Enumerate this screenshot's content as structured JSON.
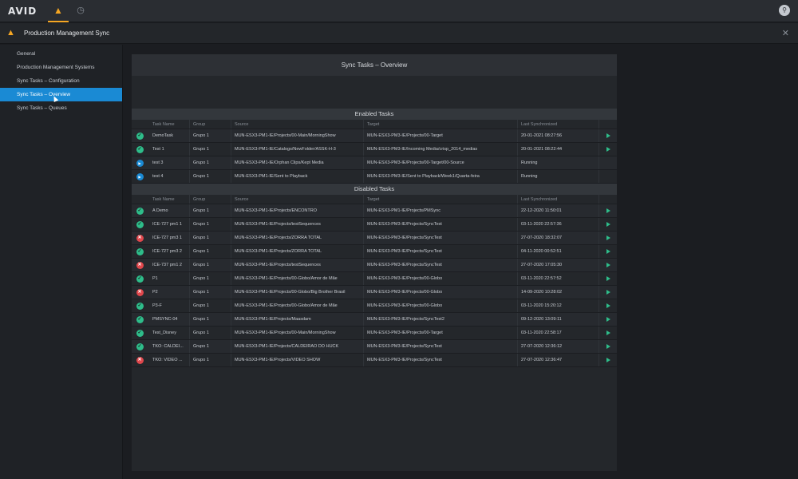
{
  "topbar": {
    "logo": "AVID",
    "app_icon": "production-management-icon",
    "history_icon": "history-icon",
    "user_icon": "user-icon",
    "user_glyph": "⚲"
  },
  "titlebar": {
    "title": "Production Management Sync",
    "close_glyph": "✕"
  },
  "sidebar": {
    "items": [
      {
        "label": "General",
        "active": false
      },
      {
        "label": "Production Management Systems",
        "active": false
      },
      {
        "label": "Sync Tasks – Configuration",
        "active": false
      },
      {
        "label": "Sync Tasks – Overview",
        "active": true
      },
      {
        "label": "Sync Tasks – Queues",
        "active": false
      }
    ]
  },
  "panel": {
    "title": "Sync Tasks – Overview",
    "columns": {
      "name": "Task Name",
      "group": "Group",
      "source": "Source",
      "target": "Target",
      "last": "Last Synchronized"
    },
    "enabled": {
      "title": "Enabled Tasks",
      "rows": [
        {
          "status": "ok",
          "name": "DemoTask",
          "group": "Grupo 1",
          "source": "MUN-ESX3-PM1-IE/Projects/00-Main/MorningShow",
          "target": "MUN-ESX3-PM3-IE/Projects/00-Target",
          "last": "20-01-2021 08:27:56",
          "action": true
        },
        {
          "status": "ok",
          "name": "Test 1",
          "group": "Grupo 1",
          "source": "MUN-ESX3-PM1-IE/Catalogs/NewFolder/ASSK-H-3",
          "target": "MUN-ESX3-PM3-IE/Incoming Media/crisp_2014_medias",
          "last": "20-01-2021 08:22:44",
          "action": true
        },
        {
          "status": "run",
          "name": "test 3",
          "group": "Grupo 1",
          "source": "MUN-ESX3-PM1-IE/Orphan Clips/Kept Media",
          "target": "MUN-ESX3-PM3-IE/Projects/00-Target/00-Source",
          "last": "Running",
          "action": false
        },
        {
          "status": "run",
          "name": "test 4",
          "group": "Grupo 1",
          "source": "MUN-ESX3-PM1-IE/Sent to Playback",
          "target": "MUN-ESX3-PM3-IE/Sent to Playback/Week1/Quarta-feira",
          "last": "Running",
          "action": false
        }
      ]
    },
    "disabled": {
      "title": "Disabled Tasks",
      "rows": [
        {
          "status": "ok",
          "name": "A Demo",
          "group": "Grupo 1",
          "source": "MUN-ESX3-PM1-IE/Projects/ENCONTRO",
          "target": "MUN-ESX3-PM1-IE/Projects/PMSync",
          "last": "22-12-2020 11:50:01",
          "action": true
        },
        {
          "status": "ok",
          "name": "ICE-727 pm1 1",
          "group": "Grupo 1",
          "source": "MUN-ESX3-PM1-IE/Projects/testSequences",
          "target": "MUN-ESX3-PM3-IE/Projects/SyncTest",
          "last": "03-11-2020 22:57:36",
          "action": true
        },
        {
          "status": "err",
          "name": "ICE-727 pm3 1",
          "group": "Grupo 1",
          "source": "MUN-ESX3-PM1-IE/Projects/ZORRA TOTAL",
          "target": "MUN-ESX3-PM3-IE/Projects/SyncTest",
          "last": "27-07-2020 18:32:07",
          "action": true
        },
        {
          "status": "ok",
          "name": "ICE-727 pm3 2",
          "group": "Grupo 1",
          "source": "MUN-ESX3-PM1-IE/Projects/ZORRA TOTAL",
          "target": "MUN-ESX3-PM3-IE/Projects/SyncTest",
          "last": "04-11-2020 00:52:51",
          "action": true
        },
        {
          "status": "err",
          "name": "ICE-737 pm1 2",
          "group": "Grupo 1",
          "source": "MUN-ESX3-PM1-IE/Projects/testSequences",
          "target": "MUN-ESX3-PM3-IE/Projects/SyncTest",
          "last": "27-07-2020 17:05:30",
          "action": true
        },
        {
          "status": "ok",
          "name": "P1",
          "group": "Grupo 1",
          "source": "MUN-ESX3-PM1-IE/Projects/00-Globo/Amor de Mãe",
          "target": "MUN-ESX3-PM3-IE/Projects/00-Globo",
          "last": "03-11-2020 22:57:52",
          "action": true
        },
        {
          "status": "err",
          "name": "P2",
          "group": "Grupo 1",
          "source": "MUN-ESX3-PM1-IE/Projects/00-Globo/Big Brother Brasil",
          "target": "MUN-ESX3-PM3-IE/Projects/00-Globo",
          "last": "14-09-2020 10:28:02",
          "action": true
        },
        {
          "status": "ok",
          "name": "P3-F",
          "group": "Grupo 1",
          "source": "MUN-ESX3-PM1-IE/Projects/00-Globo/Amor de Mãe",
          "target": "MUN-ESX3-PM3-IE/Projects/00-Globo",
          "last": "03-11-2020 15:20:12",
          "action": true
        },
        {
          "status": "ok",
          "name": "PMSYNC-04",
          "group": "Grupo 1",
          "source": "MUN-ESX3-PM1-IE/Projects/Maasdam",
          "target": "MUN-ESX3-PM3-IE/Projects/SyncTest2",
          "last": "09-12-2020 13:09:11",
          "action": true
        },
        {
          "status": "ok",
          "name": "Test_Disney",
          "group": "Grupo 1",
          "source": "MUN-ESX3-PM1-IE/Projects/00-Main/MorningShow",
          "target": "MUN-ESX3-PM3-IE/Projects/00-Target",
          "last": "03-11-2020 22:58:17",
          "action": true
        },
        {
          "status": "ok",
          "name": "TKO: CALDEI...",
          "group": "Grupo 1",
          "source": "MUN-ESX3-PM1-IE/Projects/CALDEIRAO DO HUCK",
          "target": "MUN-ESX3-PM3-IE/Projects/SyncTest",
          "last": "27-07-2020 12:36:12",
          "action": true
        },
        {
          "status": "err",
          "name": "TKO: VIDEO ...",
          "group": "Grupo 1",
          "source": "MUN-ESX3-PM1-IE/Projects/VIDEO SHOW",
          "target": "MUN-ESX3-PM3-IE/Projects/SyncTest",
          "last": "27-07-2020 12:36:47",
          "action": true
        }
      ]
    }
  },
  "colors": {
    "accent": "#1a8ad4",
    "brand": "#f5a623",
    "ok": "#2ebd8a",
    "error": "#e0474c"
  }
}
